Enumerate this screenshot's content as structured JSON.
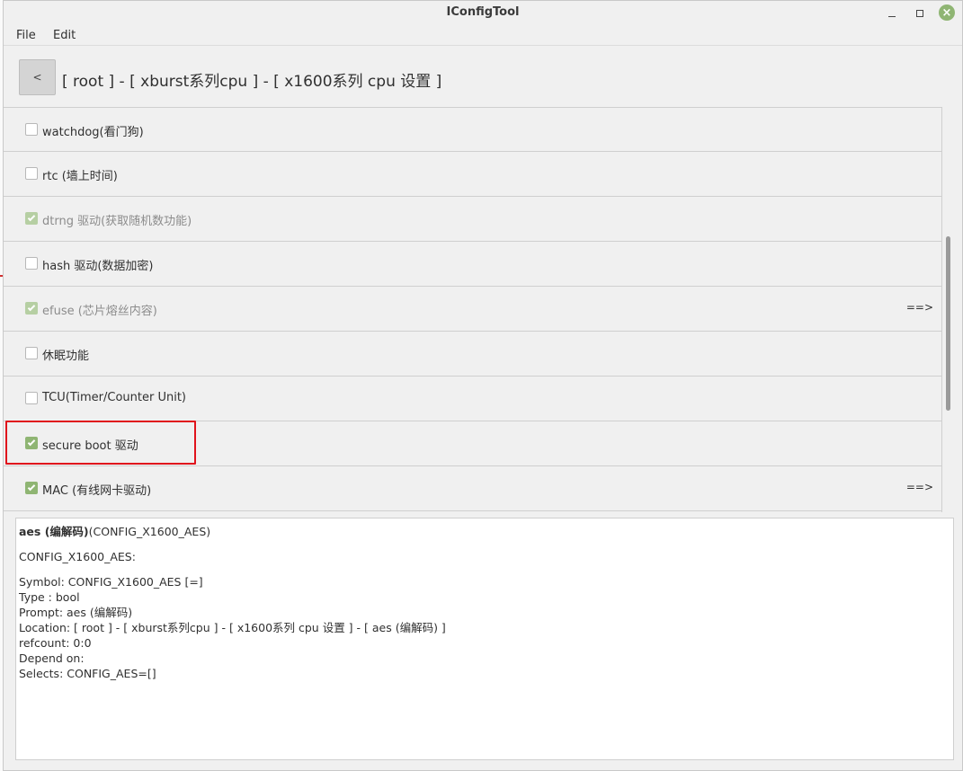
{
  "window": {
    "title": "IConfigTool"
  },
  "menu": {
    "file": "File",
    "edit": "Edit"
  },
  "header": {
    "back_label": "<",
    "breadcrumb": "[ root ] - [ xburst系列cpu ] - [ x1600系列 cpu 设置 ]"
  },
  "items": [
    {
      "label": "watchdog(看门狗)",
      "checked": false,
      "disabled": false,
      "submenu": ""
    },
    {
      "label": "rtc (墙上时间)",
      "checked": false,
      "disabled": false,
      "submenu": ""
    },
    {
      "label": "dtrng 驱动(获取随机数功能)",
      "checked": true,
      "disabled": true,
      "submenu": ""
    },
    {
      "label": "hash 驱动(数据加密)",
      "checked": false,
      "disabled": false,
      "submenu": ""
    },
    {
      "label": "efuse (芯片熔丝内容)",
      "checked": true,
      "disabled": true,
      "submenu": "==>"
    },
    {
      "label": "休眠功能",
      "checked": false,
      "disabled": false,
      "submenu": ""
    },
    {
      "label": "TCU(Timer/Counter Unit)",
      "checked": false,
      "disabled": false,
      "submenu": ""
    },
    {
      "label": "secure boot 驱动",
      "checked": true,
      "disabled": false,
      "submenu": ""
    },
    {
      "label": "MAC (有线网卡驱动)",
      "checked": true,
      "disabled": false,
      "submenu": "==>"
    }
  ],
  "scroll": {
    "position": 0.56,
    "visible_fraction": 0.43
  },
  "info": {
    "heading_bold": "aes (编解码)",
    "heading_rest": "(CONFIG_X1600_AES)",
    "config_name": "CONFIG_X1600_AES:",
    "symbol": "Symbol: CONFIG_X1600_AES [=]",
    "type": "Type : bool",
    "prompt": "Prompt: aes (编解码)",
    "location": "Location: [ root ] - [ xburst系列cpu ] - [ x1600系列 cpu 设置 ] - [ aes (编解码) ]",
    "refcount": "refcount: 0:0",
    "depend": "Depend on:",
    "selects": "Selects: CONFIG_AES=[]"
  },
  "colors": {
    "accent": "#8fb573",
    "highlight": "#e0131c"
  }
}
